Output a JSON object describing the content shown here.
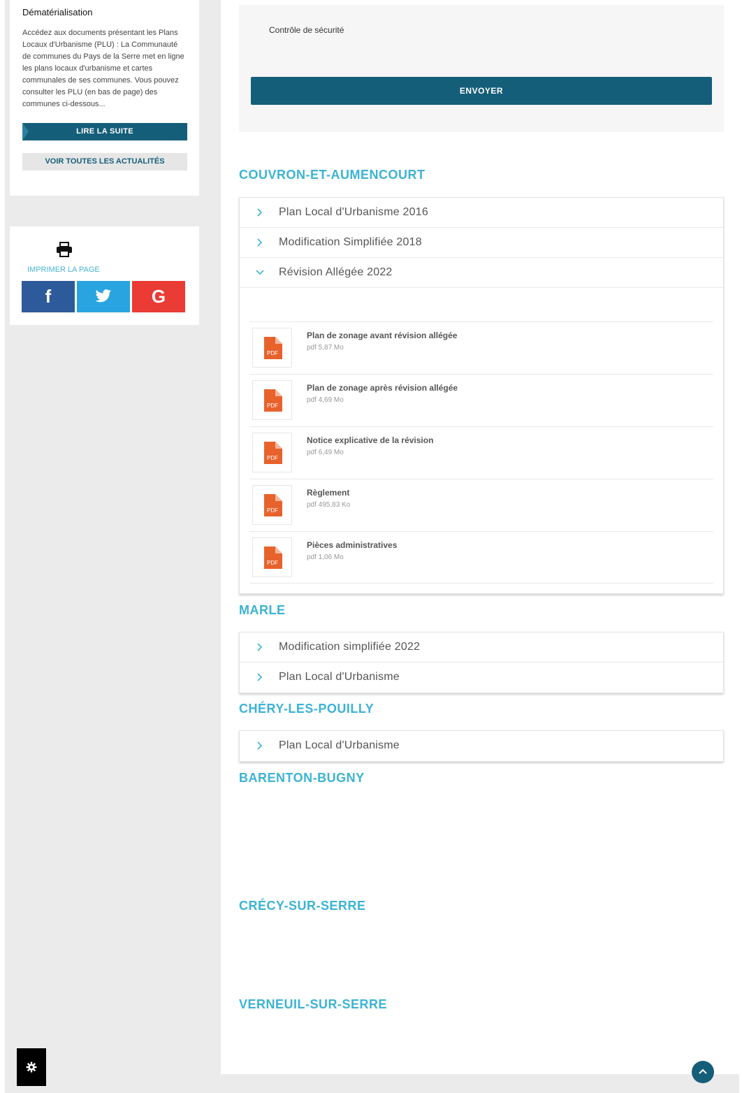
{
  "news": {
    "title": "Dématérialisation",
    "text": "Accédez aux documents présentant les Plans Locaux d'Urbanisme (PLU) : La Communauté de communes du Pays de la Serre met en ligne les plans locaux d'urbanisme et cartes communales de ses communes. Vous pouvez consulter les PLU (en bas de page) des communes ci-dessous...",
    "read_more": "LIRE LA SUITE",
    "see_all": "VOIR TOUTES LES ACTUALITÉS"
  },
  "share": {
    "print_label": "IMPRIMER LA PAGE",
    "facebook": "f",
    "google": "G"
  },
  "form": {
    "security_label": "Contrôle de sécurité",
    "submit": "ENVOYER"
  },
  "sections": [
    {
      "title": "COUVRON-ET-AUMENCOURT",
      "items": [
        {
          "label": "Plan Local d'Urbanisme 2016"
        },
        {
          "label": "Modification Simplifiée 2018"
        },
        {
          "label": "Révision Allégée 2022",
          "expanded": true
        }
      ],
      "documents": [
        {
          "name": "Plan de zonage avant révision allégée",
          "meta": "pdf 5,87 Mo"
        },
        {
          "name": "Plan de zonage après révision allégée",
          "meta": "pdf 4,69 Mo"
        },
        {
          "name": "Notice explicative de la révision",
          "meta": "pdf 6,49 Mo"
        },
        {
          "name": "Règlement",
          "meta": "pdf 495,83 Ko"
        },
        {
          "name": "Pièces administratives",
          "meta": "pdf 1,06 Mo"
        }
      ]
    },
    {
      "title": "MARLE",
      "items": [
        {
          "label": "Modification simplifiée 2022"
        },
        {
          "label": "Plan Local d'Urbanisme"
        }
      ]
    },
    {
      "title": "CHÉRY-LES-POUILLY",
      "items": [
        {
          "label": "Plan Local d'Urbanisme"
        }
      ]
    },
    {
      "title": "BARENTON-BUGNY"
    },
    {
      "title": "CRÉCY-SUR-SERRE"
    },
    {
      "title": "VERNEUIL-SUR-SERRE"
    }
  ],
  "pdf_icon_text": "PDF",
  "colors": {
    "primary": "#155e7a",
    "accent": "#3cb3d4",
    "pdf": "#e8622c",
    "facebook": "#2d5a9a",
    "twitter": "#2aa4e0",
    "google": "#ea3b34"
  },
  "icons": [
    "printer-icon",
    "facebook-icon",
    "twitter-icon",
    "google-icon",
    "chevron-right-icon",
    "chevron-down-icon",
    "pdf-file-icon",
    "gear-icon",
    "arrow-up-icon"
  ]
}
